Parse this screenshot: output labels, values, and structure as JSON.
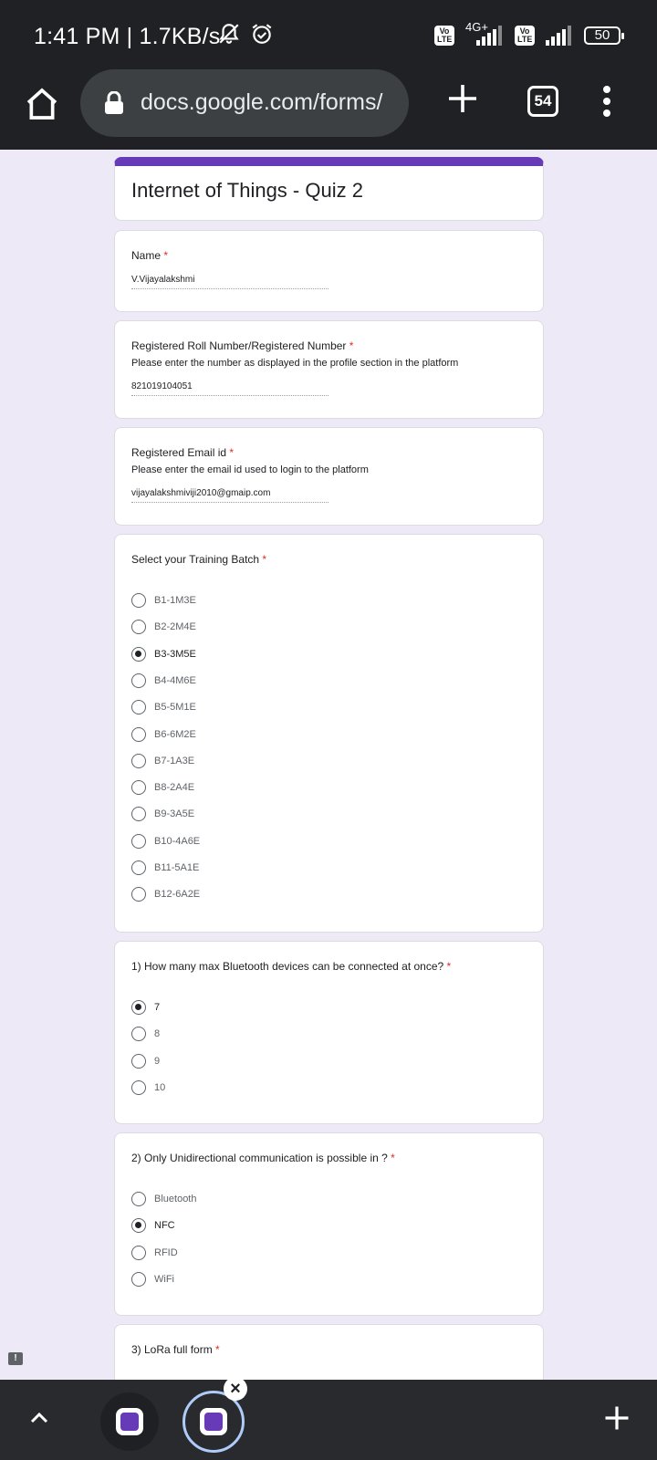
{
  "status": {
    "time_speed": "1:41 PM | 1.7KB/s",
    "network": "4G+",
    "lte": "Vo LTE",
    "battery": "50"
  },
  "browser": {
    "url": "docs.google.com/forms/",
    "tab_count": "54"
  },
  "form": {
    "title": "Internet of Things - Quiz 2",
    "name": {
      "label": "Name",
      "value": "V.Vijayalakshmi"
    },
    "roll": {
      "label": "Registered Roll Number/Registered Number",
      "help": "Please enter the number as displayed in the profile section in the platform",
      "value": "821019104051"
    },
    "email": {
      "label": "Registered Email id",
      "help": "Please enter the email id used to login to the platform",
      "value": "vijayalakshmiviji2010@gmaip.com"
    },
    "batch": {
      "label": "Select your Training Batch",
      "options": [
        "B1-1M3E",
        "B2-2M4E",
        "B3-3M5E",
        "B4-4M6E",
        "B5-5M1E",
        "B6-6M2E",
        "B7-1A3E",
        "B8-2A4E",
        "B9-3A5E",
        "B10-4A6E",
        "B11-5A1E",
        "B12-6A2E"
      ],
      "selected": "B3-3M5E"
    },
    "q1": {
      "label": "1) How many max Bluetooth devices can be connected at once?",
      "options": [
        "7",
        "8",
        "9",
        "10"
      ],
      "selected": "7"
    },
    "q2": {
      "label": "2) Only Unidirectional communication is possible in ?",
      "options": [
        "Bluetooth",
        "NFC",
        "RFID",
        "WiFi"
      ],
      "selected": "NFC"
    },
    "q3": {
      "label": "3) LoRa full form"
    },
    "required_mark": "*"
  },
  "colors": {
    "accent": "#673ab7",
    "background": "#ede9f7",
    "chrome": "#202124"
  }
}
